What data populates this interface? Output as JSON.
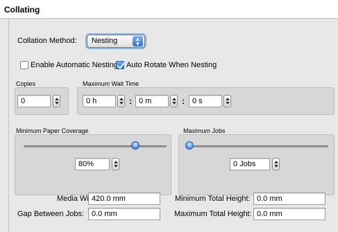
{
  "panel": {
    "title": "Collating"
  },
  "collation": {
    "label": "Collation Method:",
    "value": "Nesting"
  },
  "options": {
    "auto_nesting": {
      "label": "Enable Automatic Nesting",
      "checked": false
    },
    "auto_rotate": {
      "label": "Auto Rotate When Nesting",
      "checked": true
    }
  },
  "copies": {
    "label": "Copies",
    "value": "0"
  },
  "wait_time": {
    "label": "Maximum Wait Time",
    "hours": "0 h",
    "minutes": "0 m",
    "seconds": "0 s",
    "separator": ":"
  },
  "paper_coverage": {
    "label": "Minimum Paper Coverage",
    "value": "80%",
    "slider_fraction": 0.8
  },
  "max_jobs": {
    "label": "Maximum Jobs",
    "value": "0 Jobs",
    "slider_fraction": 0.0
  },
  "fields": {
    "media_width": {
      "label": "Media Width:",
      "value": "420.0 mm"
    },
    "gap_between_jobs": {
      "label": "Gap Between Jobs:",
      "value": "0.0 mm"
    },
    "min_total_height": {
      "label": "Minimum Total Height:",
      "value": "0.0 mm"
    },
    "max_total_height": {
      "label": "Maximum Total Height:",
      "value": "0.0 mm"
    }
  },
  "colors": {
    "accent": "#3b7fe0",
    "panel_bg": "#e8e8e8",
    "group_bg": "#d7d7d7"
  }
}
